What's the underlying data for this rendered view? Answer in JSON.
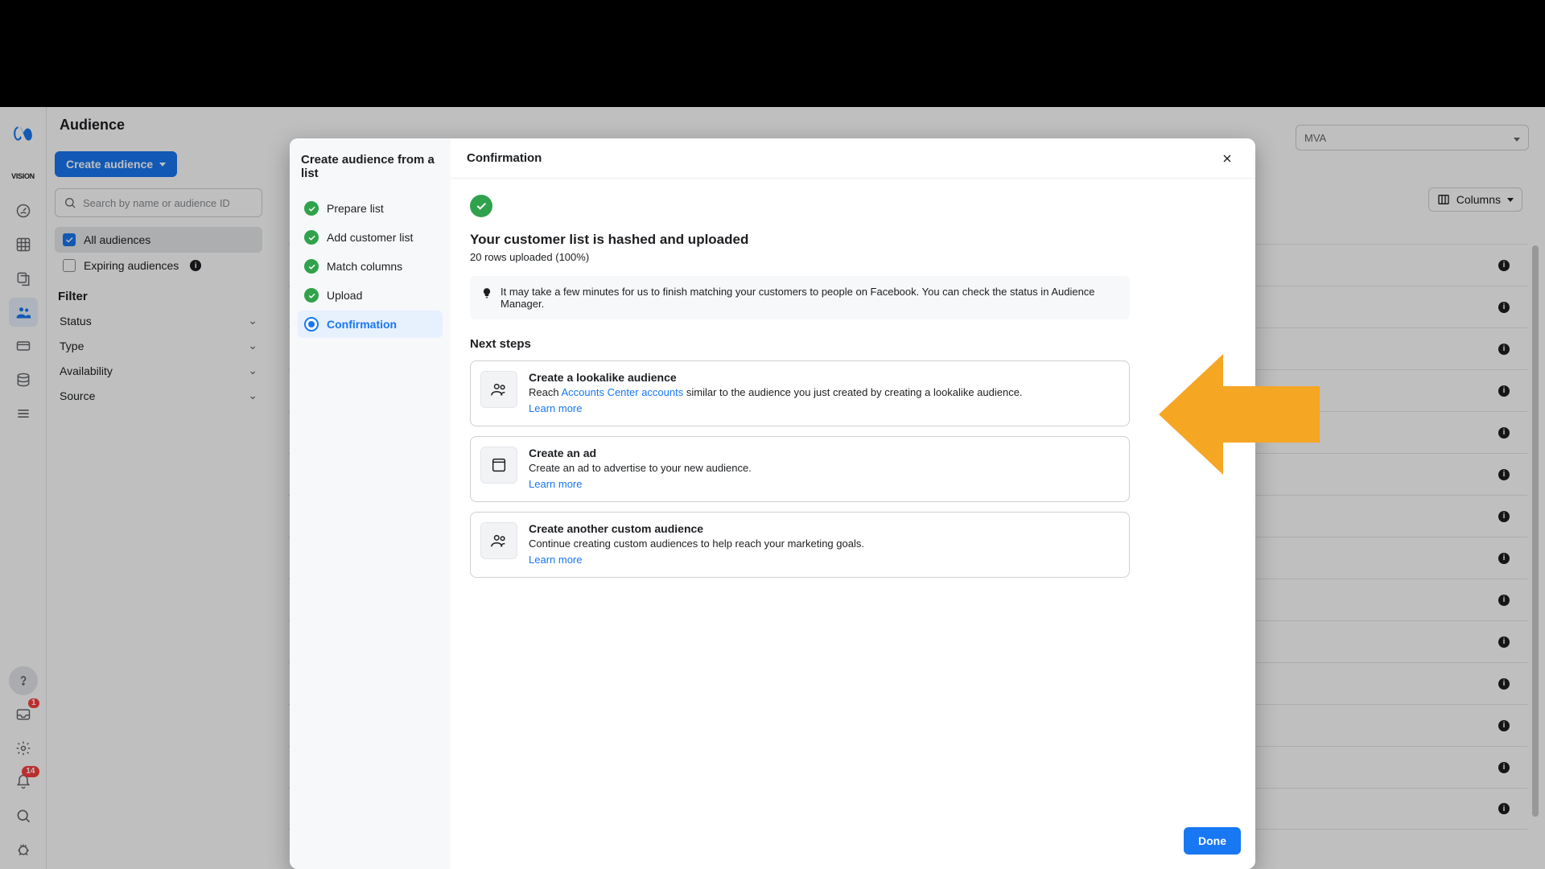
{
  "page": {
    "title": "Audience"
  },
  "account_dropdown": {
    "label": "MVA"
  },
  "sidebar": {
    "create_button": "Create audience",
    "search_placeholder": "Search by name or audience ID",
    "filters": {
      "all": "All audiences",
      "expiring": "Expiring audiences"
    },
    "filter_heading": "Filter",
    "filter_rows": [
      "Status",
      "Type",
      "Availability",
      "Source"
    ]
  },
  "columns_button": "Columns",
  "modal": {
    "side_title": "Create audience from a list",
    "steps": [
      "Prepare list",
      "Add customer list",
      "Match columns",
      "Upload",
      "Confirmation"
    ],
    "header": "Confirmation",
    "headline": "Your customer list is hashed and uploaded",
    "subline": "20 rows uploaded (100%)",
    "note": "It may take a few minutes for us to finish matching your customers to people on Facebook. You can check the status in Audience Manager.",
    "next_steps_heading": "Next steps",
    "cards": [
      {
        "title": "Create a lookalike audience",
        "text_before": "Reach ",
        "link_text": "Accounts Center accounts",
        "text_after": " similar to the audience you just created by creating a lookalike audience.",
        "learn": "Learn more"
      },
      {
        "title": "Create an ad",
        "text": "Create an ad to advertise to your new audience.",
        "learn": "Learn more"
      },
      {
        "title": "Create another custom audience",
        "text": "Continue creating custom audiences to help reach your marketing goals.",
        "learn": "Learn more"
      }
    ],
    "done": "Done"
  },
  "rail_badges": {
    "inbox": "1",
    "bell": "14"
  }
}
